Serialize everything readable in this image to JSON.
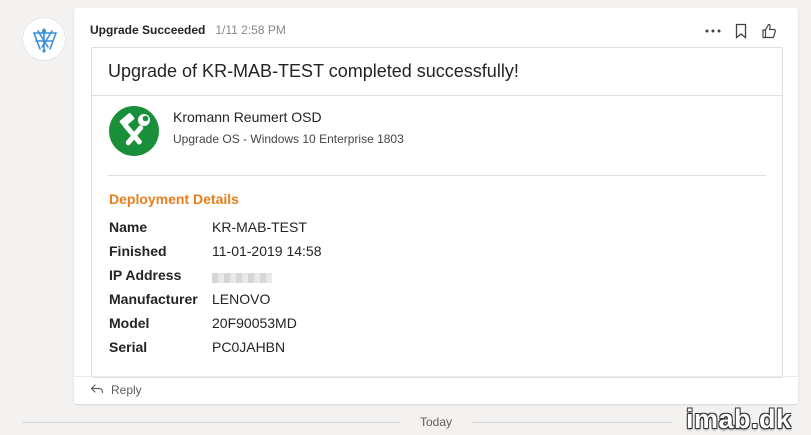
{
  "message": {
    "sender": "Upgrade Succeeded",
    "timestamp": "1/11 2:58 PM",
    "actions": {
      "more_icon": "more-options-icon",
      "bookmark_icon": "bookmark-icon",
      "like_icon": "like-icon"
    }
  },
  "card": {
    "title": "Upgrade of KR-MAB-TEST completed successfully!",
    "app_name": "Kromann Reumert OSD",
    "app_subtitle": "Upgrade OS - Windows 10 Enterprise 1803",
    "section_title": "Deployment Details",
    "facts": [
      {
        "key": "Name",
        "value": "KR-MAB-TEST"
      },
      {
        "key": "Finished",
        "value": "11-01-2019 14:58"
      },
      {
        "key": "IP Address",
        "value": ""
      },
      {
        "key": "Manufacturer",
        "value": "LENOVO"
      },
      {
        "key": "Model",
        "value": "20F90053MD"
      },
      {
        "key": "Serial",
        "value": "PC0JAHBN"
      }
    ]
  },
  "reply": {
    "label": "Reply"
  },
  "divider": {
    "label": "Today"
  },
  "watermark": "imab.dk",
  "colors": {
    "accent_orange": "#e87e1b",
    "logo_green": "#1a8f3a",
    "background": "#f3f2f1"
  }
}
